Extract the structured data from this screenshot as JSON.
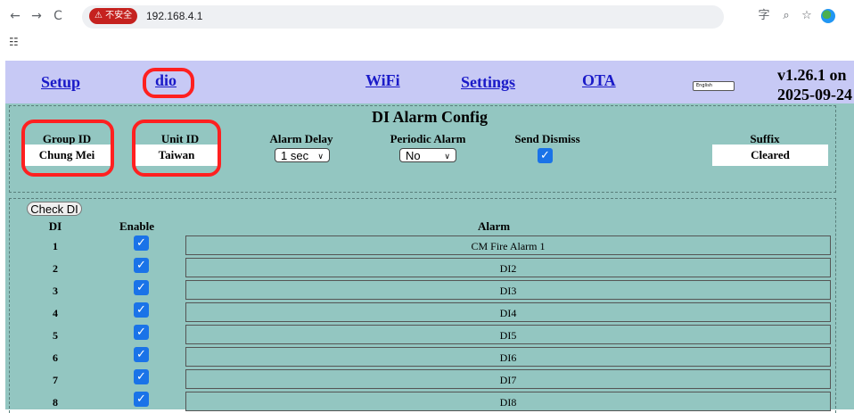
{
  "browser": {
    "back": "←",
    "forward": "→",
    "reload": "C",
    "security_badge": "⚠ 不安全",
    "url": "192.168.4.1",
    "translate_icon": "translate-icon",
    "zoom_icon": "zoom-icon",
    "star_icon": "star-icon",
    "apps_icon": "apps-grid-icon"
  },
  "menu": {
    "setup": "Setup",
    "dio": "dio",
    "wifi": "WiFi",
    "settings": "Settings",
    "ota": "OTA",
    "language": "English",
    "version_line1": "v1.26.1 on",
    "version_line2": "2025-09-24"
  },
  "config": {
    "title": "DI Alarm Config",
    "headers": {
      "group_id": "Group ID",
      "unit_id": "Unit ID",
      "alarm_delay": "Alarm Delay",
      "periodic_alarm": "Periodic Alarm",
      "send_dismiss": "Send Dismiss",
      "suffix": "Suffix"
    },
    "group_id": "Chung Mei",
    "unit_id": "Taiwan",
    "alarm_delay": "1 sec",
    "periodic_alarm": "No",
    "send_dismiss": true,
    "suffix": "Cleared"
  },
  "table": {
    "check_button": "Check DI",
    "headers": {
      "di": "DI",
      "enable": "Enable",
      "alarm": "Alarm"
    },
    "rows": [
      {
        "di": "1",
        "enabled": true,
        "alarm": "CM Fire Alarm 1"
      },
      {
        "di": "2",
        "enabled": true,
        "alarm": "DI2"
      },
      {
        "di": "3",
        "enabled": true,
        "alarm": "DI3"
      },
      {
        "di": "4",
        "enabled": true,
        "alarm": "DI4"
      },
      {
        "di": "5",
        "enabled": true,
        "alarm": "DI5"
      },
      {
        "di": "6",
        "enabled": true,
        "alarm": "DI6"
      },
      {
        "di": "7",
        "enabled": true,
        "alarm": "DI7"
      },
      {
        "di": "8",
        "enabled": true,
        "alarm": "DI8"
      }
    ]
  },
  "colors": {
    "page_bg": "#93c6c1",
    "menu_bg": "#c7c9f5",
    "link": "#1a1ac8",
    "highlight": "#ff2020",
    "checkbox": "#1a73e8"
  }
}
